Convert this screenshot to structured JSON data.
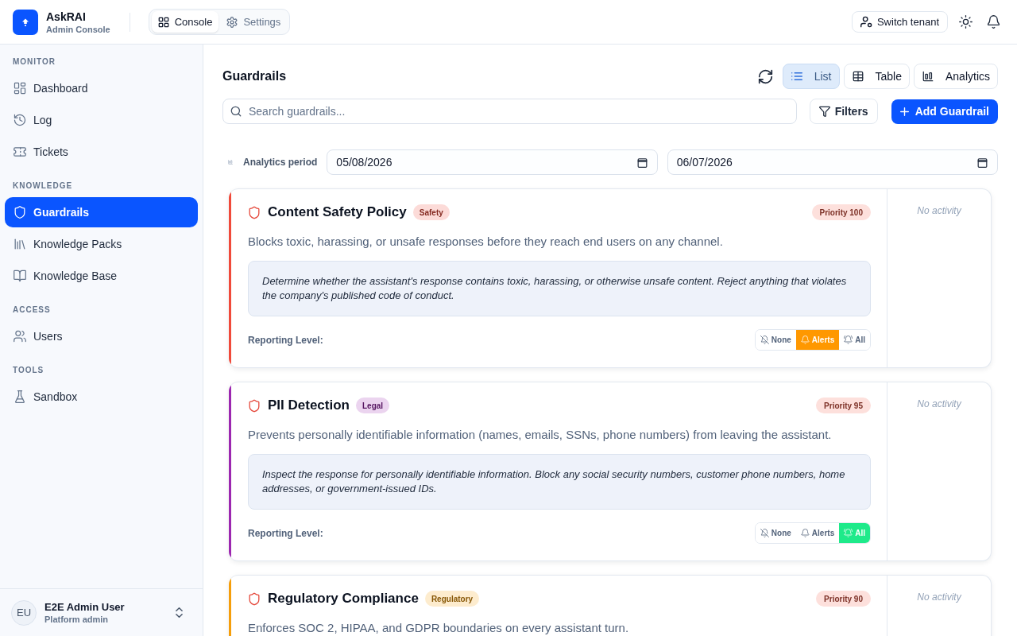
{
  "header": {
    "app_name": "AskRAI",
    "app_subtitle": "Admin Console",
    "tabs": [
      {
        "label": "Console",
        "kind": "console",
        "selected": true
      },
      {
        "label": "Settings",
        "kind": "settings",
        "selected": false
      }
    ],
    "switch_tenant": "Switch tenant"
  },
  "sidebar": {
    "sections": [
      {
        "title": "MONITOR",
        "items": [
          {
            "label": "Dashboard",
            "kind": "dashboard",
            "selected": false
          },
          {
            "label": "Log",
            "kind": "log",
            "selected": false
          },
          {
            "label": "Tickets",
            "kind": "tickets",
            "selected": false
          }
        ]
      },
      {
        "title": "KNOWLEDGE",
        "items": [
          {
            "label": "Guardrails",
            "kind": "guardrails",
            "selected": true
          },
          {
            "label": "Knowledge Packs",
            "kind": "packs",
            "selected": false
          },
          {
            "label": "Knowledge Base",
            "kind": "base",
            "selected": false
          }
        ]
      },
      {
        "title": "ACCESS",
        "items": [
          {
            "label": "Users",
            "kind": "users",
            "selected": false
          }
        ]
      },
      {
        "title": "TOOLS",
        "items": [
          {
            "label": "Sandbox",
            "kind": "sandbox",
            "selected": false
          }
        ]
      }
    ],
    "user": {
      "initials": "EU",
      "name": "E2E Admin User",
      "role": "Platform admin"
    }
  },
  "main": {
    "title": "Guardrails",
    "views": [
      {
        "label": "List",
        "kind": "list",
        "selected": true
      },
      {
        "label": "Table",
        "kind": "table",
        "selected": false
      },
      {
        "label": "Analytics",
        "kind": "analytics",
        "selected": false
      }
    ],
    "search": {
      "placeholder": "Search guardrails..."
    },
    "filters_button": "Filters",
    "add_button": "Add Guardrail",
    "analytics_period": {
      "label": "Analytics period",
      "start": "05/08/2026",
      "end": "06/07/2026"
    },
    "guardrails": [
      {
        "name": "Content Safety Policy",
        "category": "Safety",
        "color": "#f04a3a",
        "priority": "Priority 100",
        "description": "Blocks toxic, harassing, or unsafe responses before they reach end users on any channel.",
        "prompt": "Determine whether the assistant's response contains toxic, harassing, or otherwise unsafe content. Reject anything that violates the company's published code of conduct.",
        "reporting_label": "Reporting Level:",
        "reporting_levels": [
          {
            "label": "None",
            "kind": "none",
            "selected": false
          },
          {
            "label": "Alerts",
            "kind": "alerts",
            "selected": true
          },
          {
            "label": "All",
            "kind": "all",
            "selected": false
          }
        ],
        "activity": "No activity"
      },
      {
        "name": "PII Detection",
        "category": "Legal",
        "color": "#9c27b0",
        "priority": "Priority 95",
        "description": "Prevents personally identifiable information (names, emails, SSNs, phone numbers) from leaving the assistant.",
        "prompt": "Inspect the response for personally identifiable information. Block any social security numbers, customer phone numbers, home addresses, or government-issued IDs.",
        "reporting_label": "Reporting Level:",
        "reporting_levels": [
          {
            "label": "None",
            "kind": "none",
            "selected": false
          },
          {
            "label": "Alerts",
            "kind": "alerts",
            "selected": false
          },
          {
            "label": "All",
            "kind": "all",
            "selected": true
          }
        ],
        "activity": "No activity"
      },
      {
        "name": "Regulatory Compliance",
        "category": "Regulatory",
        "color": "#f59e0b",
        "priority": "Priority 90",
        "description": "Enforces SOC 2, HIPAA, and GDPR boundaries on every assistant turn.",
        "activity": "No activity"
      }
    ]
  }
}
